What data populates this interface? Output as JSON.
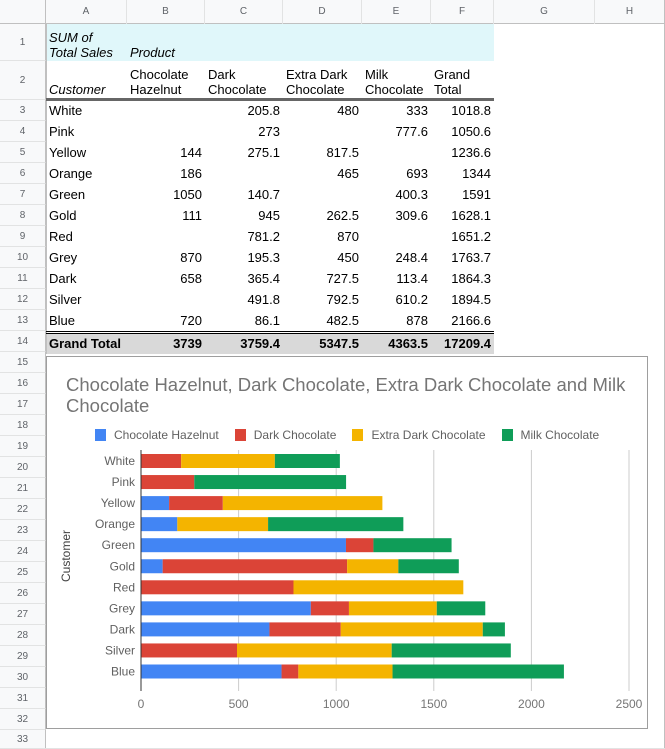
{
  "spreadsheet": {
    "column_headers": [
      "A",
      "B",
      "C",
      "D",
      "E",
      "F",
      "G",
      "H"
    ],
    "row_numbers": [
      "1",
      "2",
      "3",
      "4",
      "5",
      "6",
      "7",
      "8",
      "9",
      "10",
      "11",
      "12",
      "13",
      "14",
      "15",
      "16",
      "17",
      "18",
      "19",
      "20",
      "21",
      "22",
      "23",
      "24",
      "25",
      "26",
      "27",
      "28",
      "29",
      "30",
      "31",
      "32",
      "33"
    ]
  },
  "pivot": {
    "corner_label_line1": "SUM of",
    "corner_label_line2": "Total Sales",
    "columns_field_label": "Product",
    "rows_field_label": "Customer",
    "column_labels": [
      {
        "line1": "Chocolate",
        "line2": "Hazelnut"
      },
      {
        "line1": "Dark",
        "line2": "Chocolate"
      },
      {
        "line1": "Extra Dark",
        "line2": "Chocolate"
      },
      {
        "line1": "Milk",
        "line2": "Chocolate"
      },
      {
        "line1": "Grand",
        "line2": "Total"
      }
    ],
    "rows": [
      {
        "customer": "White",
        "values": [
          "",
          "205.8",
          "480",
          "333",
          "1018.8"
        ]
      },
      {
        "customer": "Pink",
        "values": [
          "",
          "273",
          "",
          "777.6",
          "1050.6"
        ]
      },
      {
        "customer": "Yellow",
        "values": [
          "144",
          "275.1",
          "817.5",
          "",
          "1236.6"
        ]
      },
      {
        "customer": "Orange",
        "values": [
          "186",
          "",
          "465",
          "693",
          "1344"
        ]
      },
      {
        "customer": "Green",
        "values": [
          "1050",
          "140.7",
          "",
          "400.3",
          "1591"
        ]
      },
      {
        "customer": "Gold",
        "values": [
          "111",
          "945",
          "262.5",
          "309.6",
          "1628.1"
        ]
      },
      {
        "customer": "Red",
        "values": [
          "",
          "781.2",
          "870",
          "",
          "1651.2"
        ]
      },
      {
        "customer": "Grey",
        "values": [
          "870",
          "195.3",
          "450",
          "248.4",
          "1763.7"
        ]
      },
      {
        "customer": "Dark",
        "values": [
          "658",
          "365.4",
          "727.5",
          "113.4",
          "1864.3"
        ]
      },
      {
        "customer": "Silver",
        "values": [
          "",
          "491.8",
          "792.5",
          "610.2",
          "1894.5"
        ]
      },
      {
        "customer": "Blue",
        "values": [
          "720",
          "86.1",
          "482.5",
          "878",
          "2166.6"
        ]
      }
    ],
    "grand_total": {
      "label": "Grand Total",
      "values": [
        "3739",
        "3759.4",
        "5347.5",
        "4363.5",
        "17209.4"
      ]
    }
  },
  "chart_data": {
    "type": "bar",
    "orientation": "horizontal",
    "stacked": true,
    "title": "Chocolate Hazelnut, Dark Chocolate, Extra Dark Chocolate and Milk Chocolate",
    "xlabel": "",
    "ylabel": "Customer",
    "xlim": [
      0,
      2500
    ],
    "x_ticks": [
      "0",
      "500",
      "1000",
      "1500",
      "2000",
      "2500"
    ],
    "x_tick_values": [
      0,
      500,
      1000,
      1500,
      2000,
      2500
    ],
    "grid": true,
    "legend_position": "top",
    "categories": [
      "White",
      "Pink",
      "Yellow",
      "Orange",
      "Green",
      "Gold",
      "Red",
      "Grey",
      "Dark",
      "Silver",
      "Blue"
    ],
    "series": [
      {
        "name": "Chocolate Hazelnut",
        "color": "#4285f4",
        "values": [
          0,
          0,
          144,
          186,
          1050,
          111,
          0,
          870,
          658,
          0,
          720
        ]
      },
      {
        "name": "Dark Chocolate",
        "color": "#db4437",
        "values": [
          205.8,
          273,
          275.1,
          0,
          140.7,
          945,
          781.2,
          195.3,
          365.4,
          491.8,
          86.1
        ]
      },
      {
        "name": "Extra Dark Chocolate",
        "color": "#f4b400",
        "values": [
          480,
          0,
          817.5,
          465,
          0,
          262.5,
          870,
          450,
          727.5,
          792.5,
          482.5
        ]
      },
      {
        "name": "Milk Chocolate",
        "color": "#0f9d58",
        "values": [
          333,
          777.6,
          0,
          693,
          400.3,
          309.6,
          0,
          248.4,
          113.4,
          610.2,
          878
        ]
      }
    ]
  },
  "colors": {
    "pivot_header_bg": "#e0f7fa",
    "grand_total_bg": "#d9d9d9"
  }
}
